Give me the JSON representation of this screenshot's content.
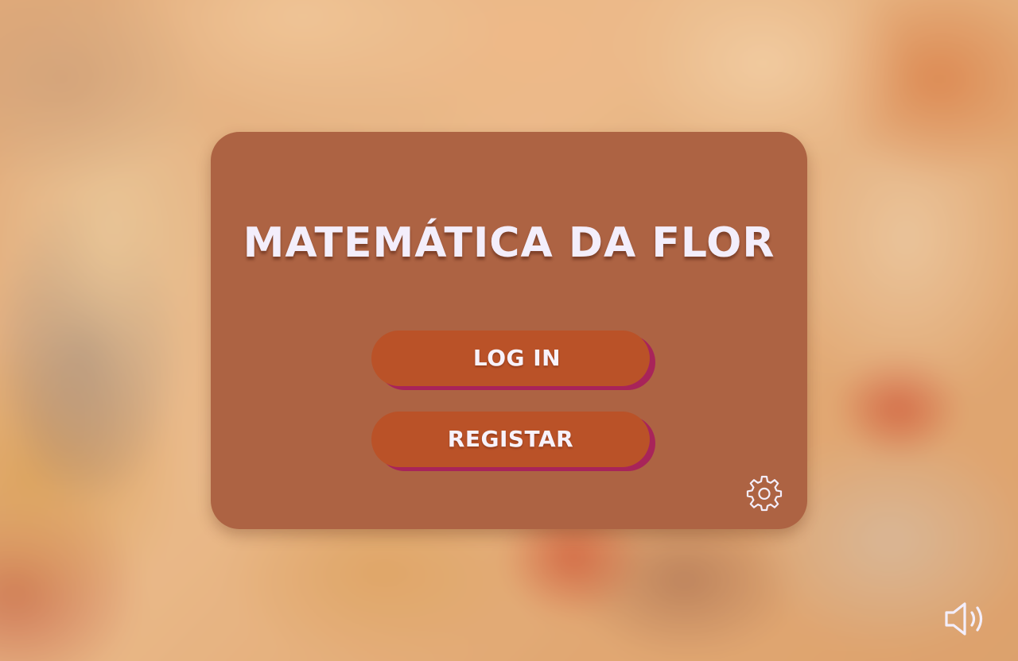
{
  "game": {
    "title": "MATEMÁTICA DA FLOR"
  },
  "menu": {
    "login_label": "LOG IN",
    "register_label": "REGISTAR"
  },
  "icons": {
    "settings": "gear-icon",
    "sound": "speaker-volume-icon"
  },
  "colors": {
    "panel": "#ad6343",
    "button": "#ba5228",
    "button_shadow": "#a8245a",
    "text": "#f3eefb"
  }
}
